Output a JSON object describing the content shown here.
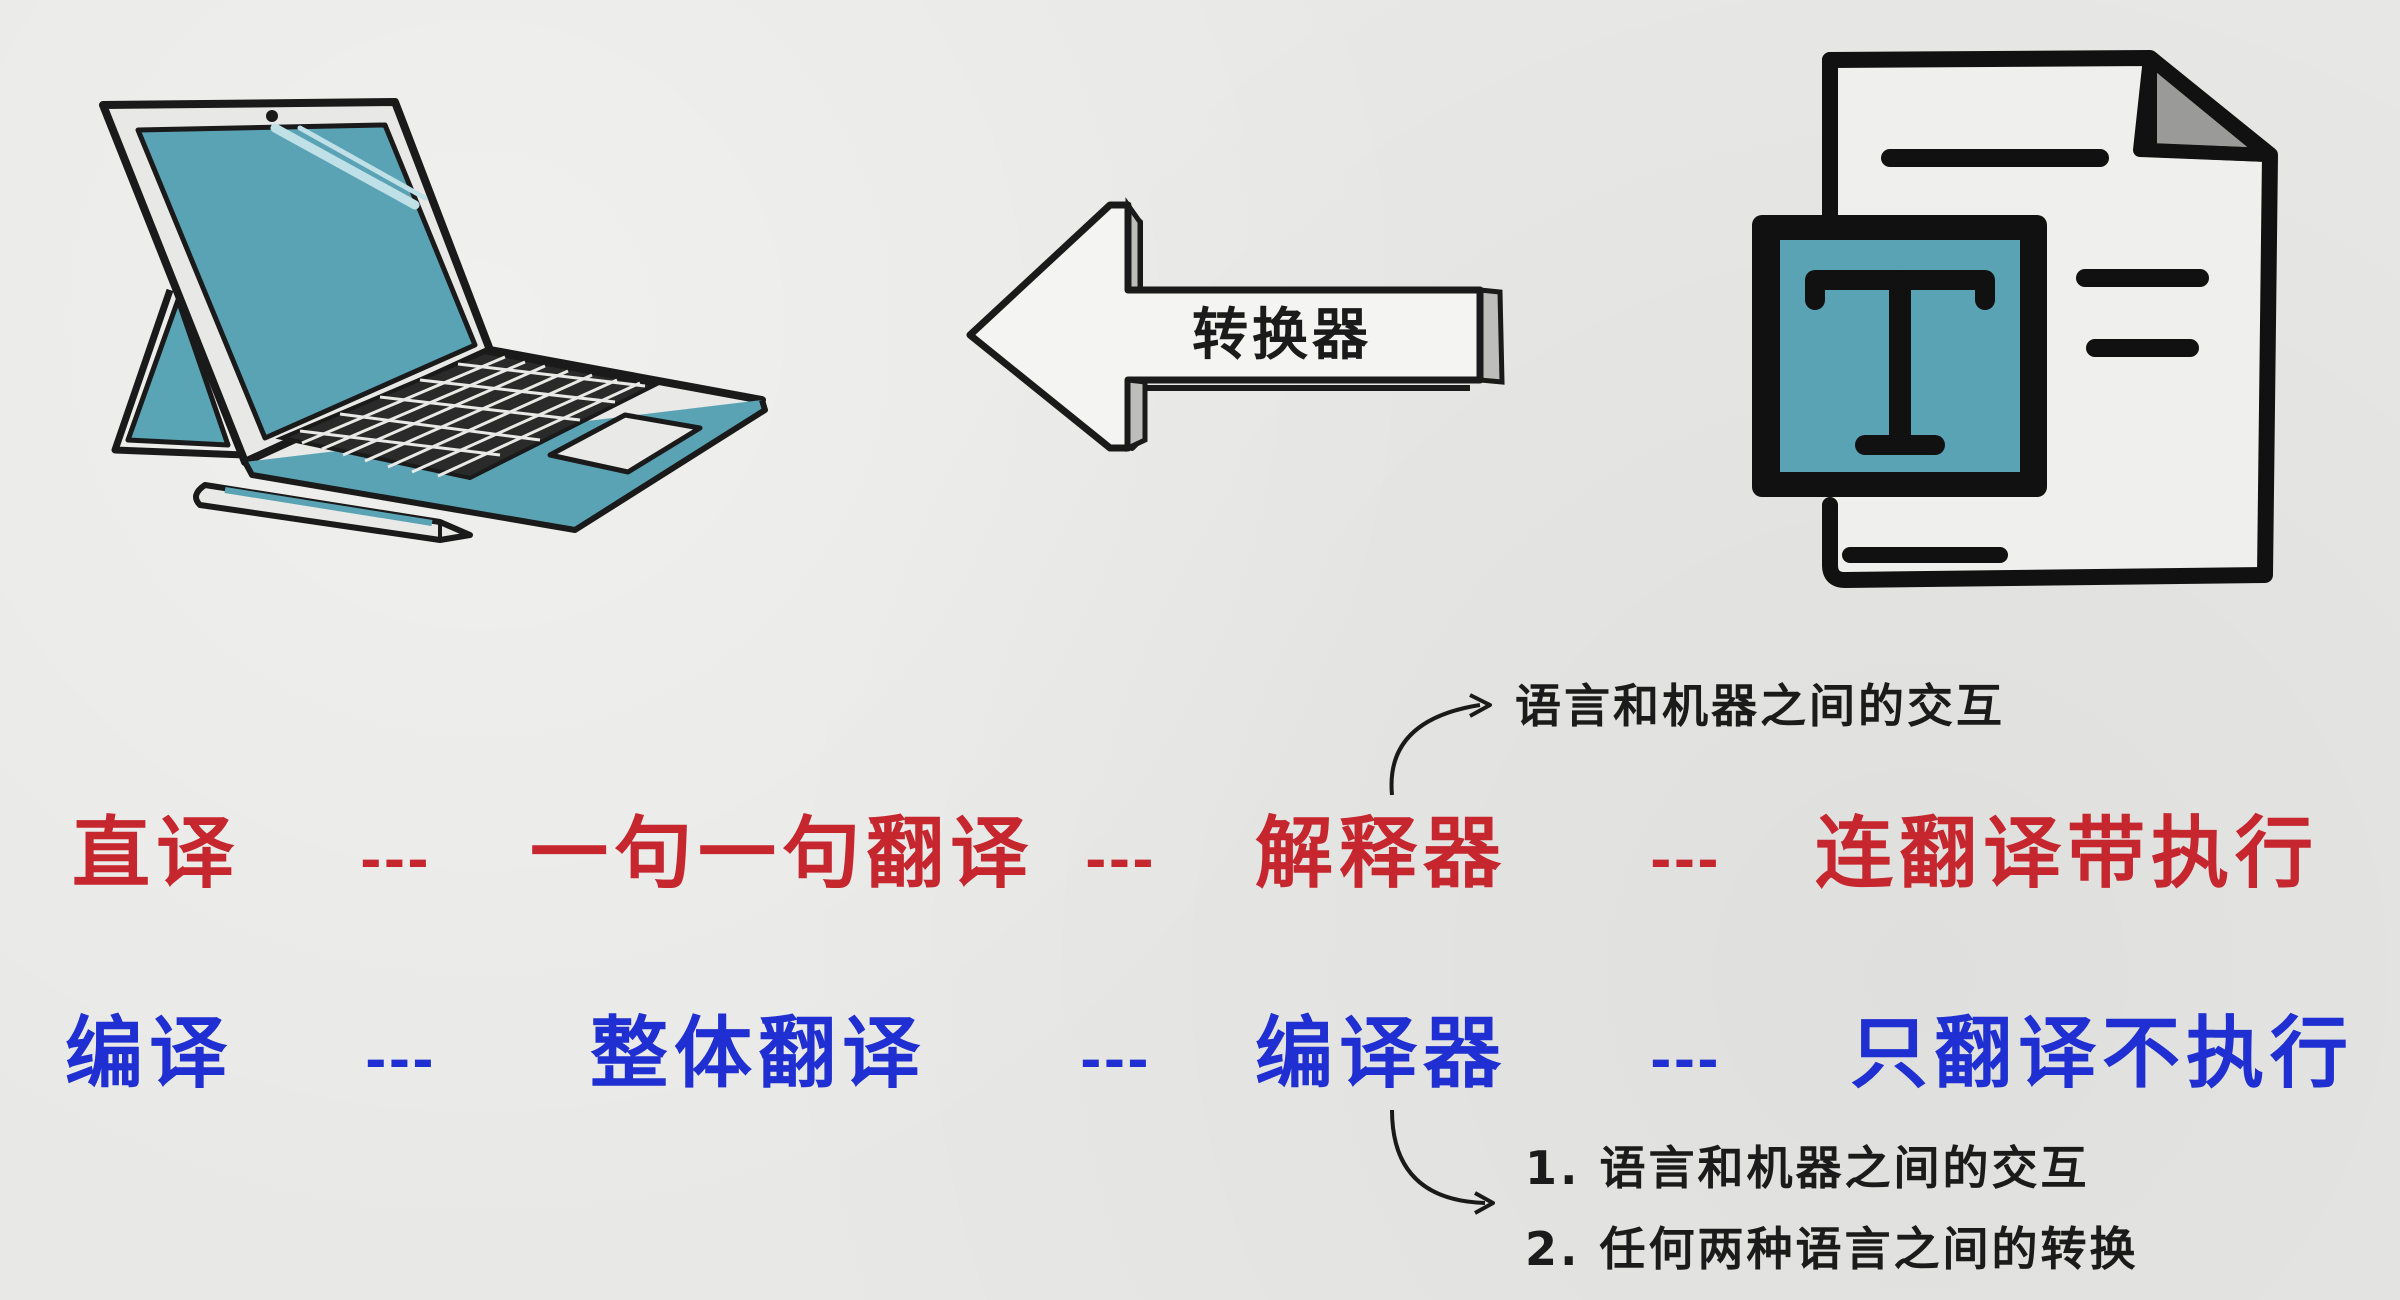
{
  "converter": {
    "label": "转换器"
  },
  "row_interpret": {
    "color": "#c6262e",
    "items": [
      "直译",
      "一句一句翻译",
      "解释器",
      "连翻译带执行"
    ],
    "separator": "---"
  },
  "row_compile": {
    "color": "#1f2fd1",
    "items": [
      "编译",
      "整体翻译",
      "编译器",
      "只翻译不执行"
    ],
    "separator": "---"
  },
  "interpreter_note": "语言和机器之间的交互",
  "compiler_notes": [
    "1. 语言和机器之间的交互",
    "2. 任何两种语言之间的转换"
  ],
  "icons": {
    "laptop": "laptop-icon",
    "pen": "stylus-pen-icon",
    "document": "text-document-icon",
    "arrow": "left-arrow-icon"
  }
}
